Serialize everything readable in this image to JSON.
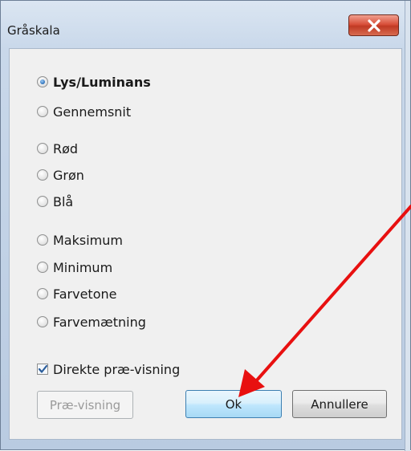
{
  "window": {
    "title": "Gråskala"
  },
  "radio_groups": [
    {
      "label": "Lys/Luminans",
      "checked": true
    },
    {
      "label": "Gennemsnit",
      "checked": false
    },
    {
      "label": "Rød",
      "checked": false
    },
    {
      "label": "Grøn",
      "checked": false
    },
    {
      "label": "Blå",
      "checked": false
    },
    {
      "label": "Maksimum",
      "checked": false
    },
    {
      "label": "Minimum",
      "checked": false
    },
    {
      "label": "Farvetone",
      "checked": false
    },
    {
      "label": "Farvemætning",
      "checked": false
    }
  ],
  "checkbox": {
    "label": "Direkte præ-visning",
    "checked": true
  },
  "buttons": {
    "preview": "Præ-visning",
    "ok": "Ok",
    "cancel": "Annullere"
  },
  "colors": {
    "annotation_arrow": "#e81010",
    "close_button": "#c13a24",
    "ok_border": "#3c7fb1"
  }
}
